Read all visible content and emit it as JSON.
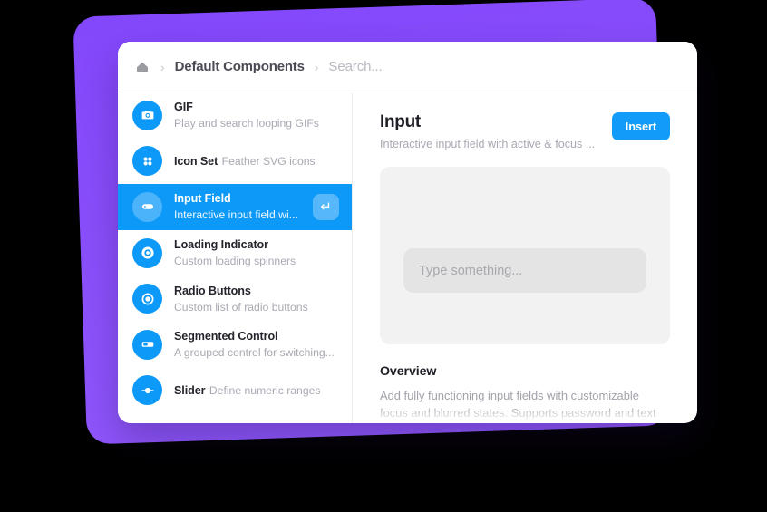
{
  "theme": {
    "background": "#000000",
    "backdrop_purple": "#8b4ffb",
    "accent_blue": "#0d99f8",
    "insert_blue": "#139bfa",
    "card_white": "#ffffff",
    "preview_gray": "#f2f2f3",
    "input_gray": "#e4e4e5"
  },
  "breadcrumb": {
    "home_icon": "home-icon",
    "separator": "›",
    "title": "Default Components",
    "search_placeholder": "Search..."
  },
  "sidebar": {
    "items": [
      {
        "title": "GIF",
        "subtitle": "Play and search looping GIFs",
        "icon": "camera-icon",
        "selected": false
      },
      {
        "title": "Icon Set",
        "subtitle": "Feather SVG icons",
        "icon": "grid-dots-icon",
        "selected": false
      },
      {
        "title": "Input Field",
        "subtitle": "Interactive input field wi...",
        "icon": "input-field-icon",
        "selected": true,
        "badge": "↵"
      },
      {
        "title": "Loading Indicator",
        "subtitle": "Custom loading spinners",
        "icon": "spinner-ring-icon",
        "selected": false
      },
      {
        "title": "Radio Buttons",
        "subtitle": "Custom list of radio buttons",
        "icon": "radio-button-icon",
        "selected": false
      },
      {
        "title": "Segmented Control",
        "subtitle": "A grouped control for switching...",
        "icon": "segmented-control-icon",
        "selected": false
      },
      {
        "title": "Slider",
        "subtitle": "Define numeric ranges",
        "icon": "slider-icon",
        "selected": false
      }
    ]
  },
  "detail": {
    "title": "Input",
    "subtitle": "Interactive input field with active & focus ...",
    "insert_label": "Insert",
    "preview": {
      "input_value": "",
      "input_placeholder": "Type something..."
    },
    "overview": {
      "heading": "Overview",
      "text": "Add fully functioning input fields with customizable focus and blurred states. Supports password and text"
    }
  }
}
